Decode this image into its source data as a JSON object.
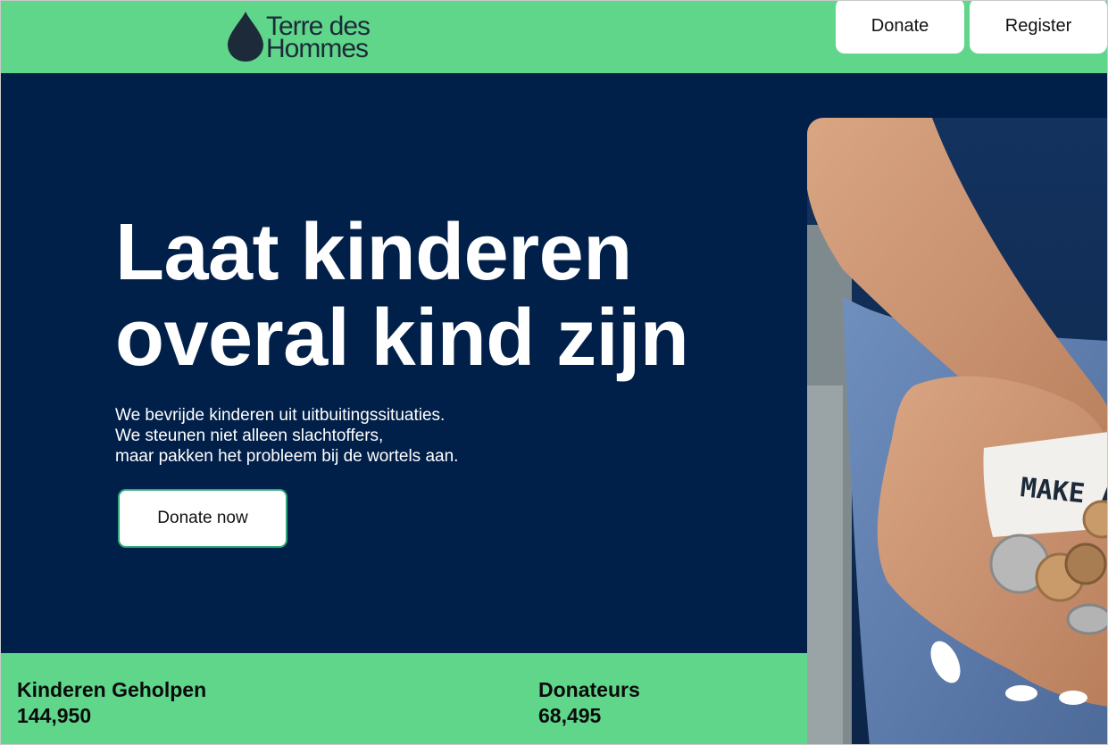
{
  "header": {
    "logo": {
      "line1": "Terre des",
      "line2": "Hommes"
    },
    "donate_label": "Donate",
    "register_label": "Register"
  },
  "hero": {
    "title_line1": "Laat kinderen",
    "title_line2": "overal kind zijn",
    "subtitle_lines": [
      "We bevrijde kinderen uit uitbuitingssituaties.",
      "We steunen niet alleen slachtoffers,",
      "maar pakken het probleem bij de wortels aan."
    ],
    "cta_label": "Donate now",
    "photo_note_text": "MAKE A"
  },
  "stats": [
    {
      "label": "Kinderen Geholpen",
      "value": "144,950"
    },
    {
      "label": "Donateurs",
      "value": "68,495"
    }
  ],
  "colors": {
    "brand_green": "#5fd68a",
    "hero_navy": "#012049",
    "logo_dark": "#1d2a3a",
    "cta_border": "#2fa87a"
  },
  "icons": {
    "logo": "water-drop-icon"
  }
}
